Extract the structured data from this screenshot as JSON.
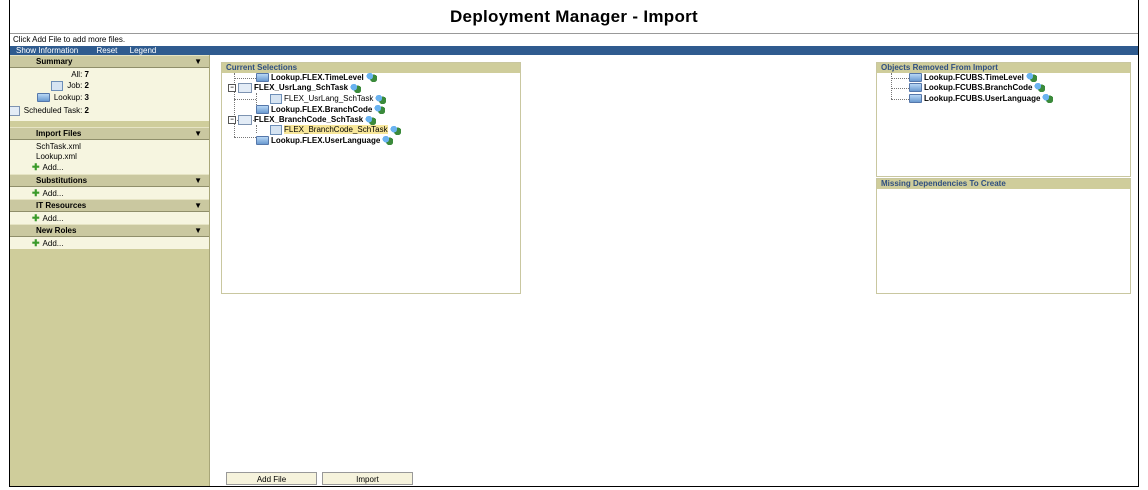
{
  "app": {
    "title": "Deployment Manager - Import"
  },
  "hint": "Click Add File to add more files.",
  "menu": {
    "show_information": "Show Information",
    "reset": "Reset",
    "legend": "Legend"
  },
  "sidebar": {
    "summary": {
      "heading": "Summary",
      "all_label": "All:",
      "all_value": "7",
      "job_label": "Job:",
      "job_value": "2",
      "lookup_label": "Lookup:",
      "lookup_value": "3",
      "scheduled_label": "Scheduled Task:",
      "scheduled_value": "2"
    },
    "import_files": {
      "heading": "Import Files",
      "files": [
        "SchTask.xml",
        "Lookup.xml"
      ],
      "add": "Add..."
    },
    "substitutions": {
      "heading": "Substitutions",
      "add": "Add..."
    },
    "it_resources": {
      "heading": "IT Resources",
      "add": "Add..."
    },
    "new_roles": {
      "heading": "New Roles",
      "add": "Add..."
    }
  },
  "current_selections": {
    "heading": "Current Selections",
    "items": [
      "Lookup.FLEX.TimeLevel",
      "FLEX_UsrLang_SchTask",
      "FLEX_UsrLang_SchTask",
      "Lookup.FLEX.BranchCode",
      "FLEX_BranchCode_SchTask",
      "FLEX_BranchCode_SchTask",
      "Lookup.FLEX.UserLanguage"
    ]
  },
  "removed": {
    "heading": "Objects Removed From Import",
    "items": [
      "Lookup.FCUBS.TimeLevel",
      "Lookup.FCUBS.BranchCode",
      "Lookup.FCUBS.UserLanguage"
    ]
  },
  "missing": {
    "heading": "Missing Dependencies To Create"
  },
  "buttons": {
    "add_file": "Add File",
    "import": "Import"
  }
}
